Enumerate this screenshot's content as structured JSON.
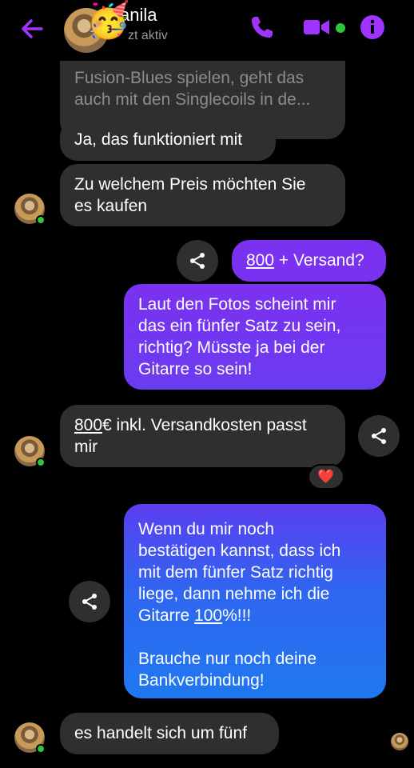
{
  "header": {
    "contact_name": "anila",
    "status": "zt aktiv",
    "avatar_emoji": "🥳",
    "accent_color": "#a033ff"
  },
  "messages": {
    "m1_line1": "Fusion-Blues spielen, geht das",
    "m1_line2": "auch mit den Singlecoils in de...",
    "m2": "Ja, das funktioniert mit",
    "m3_line1": "Zu welchem Preis möchten Sie",
    "m3_line2": "es kaufen",
    "m4_underlined": "800",
    "m4_rest": " + Versand?",
    "m5_line1": "Laut den Fotos scheint mir",
    "m5_line2": "das ein fünfer Satz zu sein,",
    "m5_line3": "richtig? Müsste ja bei der",
    "m5_line4": "Gitarre so sein!",
    "m6_underlined": "800",
    "m6_line1_rest": "€ inkl. Versandkosten passt",
    "m6_line2": "mir",
    "m6_reaction": "❤️",
    "m7_line1": "Wenn du mir noch",
    "m7_line2": "bestätigen kannst, dass ich",
    "m7_line3": "mit dem fünfer Satz richtig",
    "m7_line4": "liege, dann nehme ich die",
    "m7_line5_pre": "Gitarre ",
    "m7_line5_underlined": "100",
    "m7_line5_post": "%!!!",
    "m7_line6": "Brauche nur noch deine",
    "m7_line7": "Bankverbindung!",
    "m8": "es handelt sich um fünf"
  }
}
